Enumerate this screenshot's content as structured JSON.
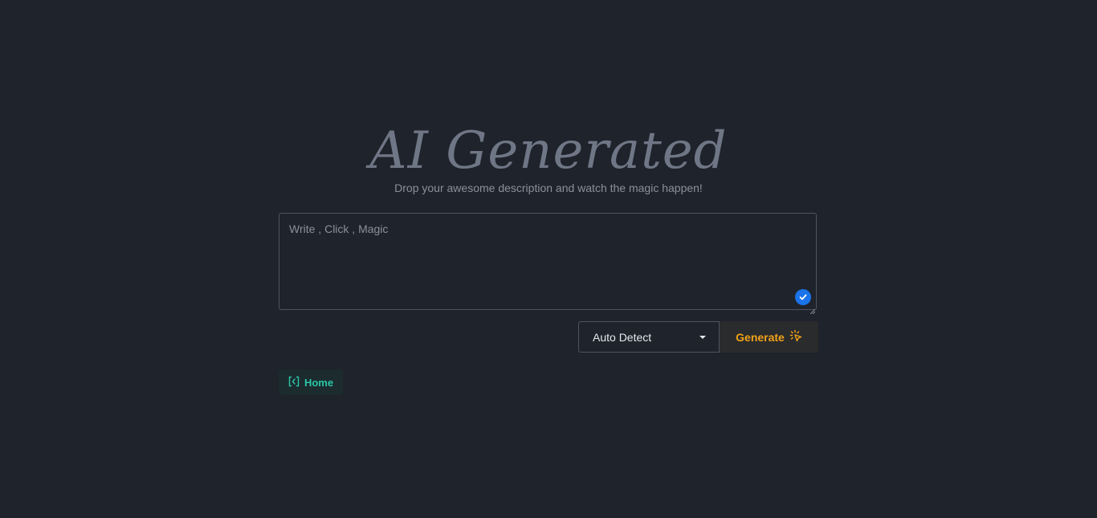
{
  "hero": {
    "title": "AI Generated",
    "subtitle": "Drop your awesome description and watch the magic happen!"
  },
  "prompt": {
    "placeholder": "Write , Click , Magic",
    "value": ""
  },
  "language_select": {
    "selected": "Auto Detect"
  },
  "actions": {
    "generate_label": "Generate",
    "home_label": "Home"
  },
  "colors": {
    "background": "#1f232b",
    "accent_generate": "#f0a21a",
    "accent_home": "#2ac6a6",
    "badge": "#1a73e8"
  }
}
